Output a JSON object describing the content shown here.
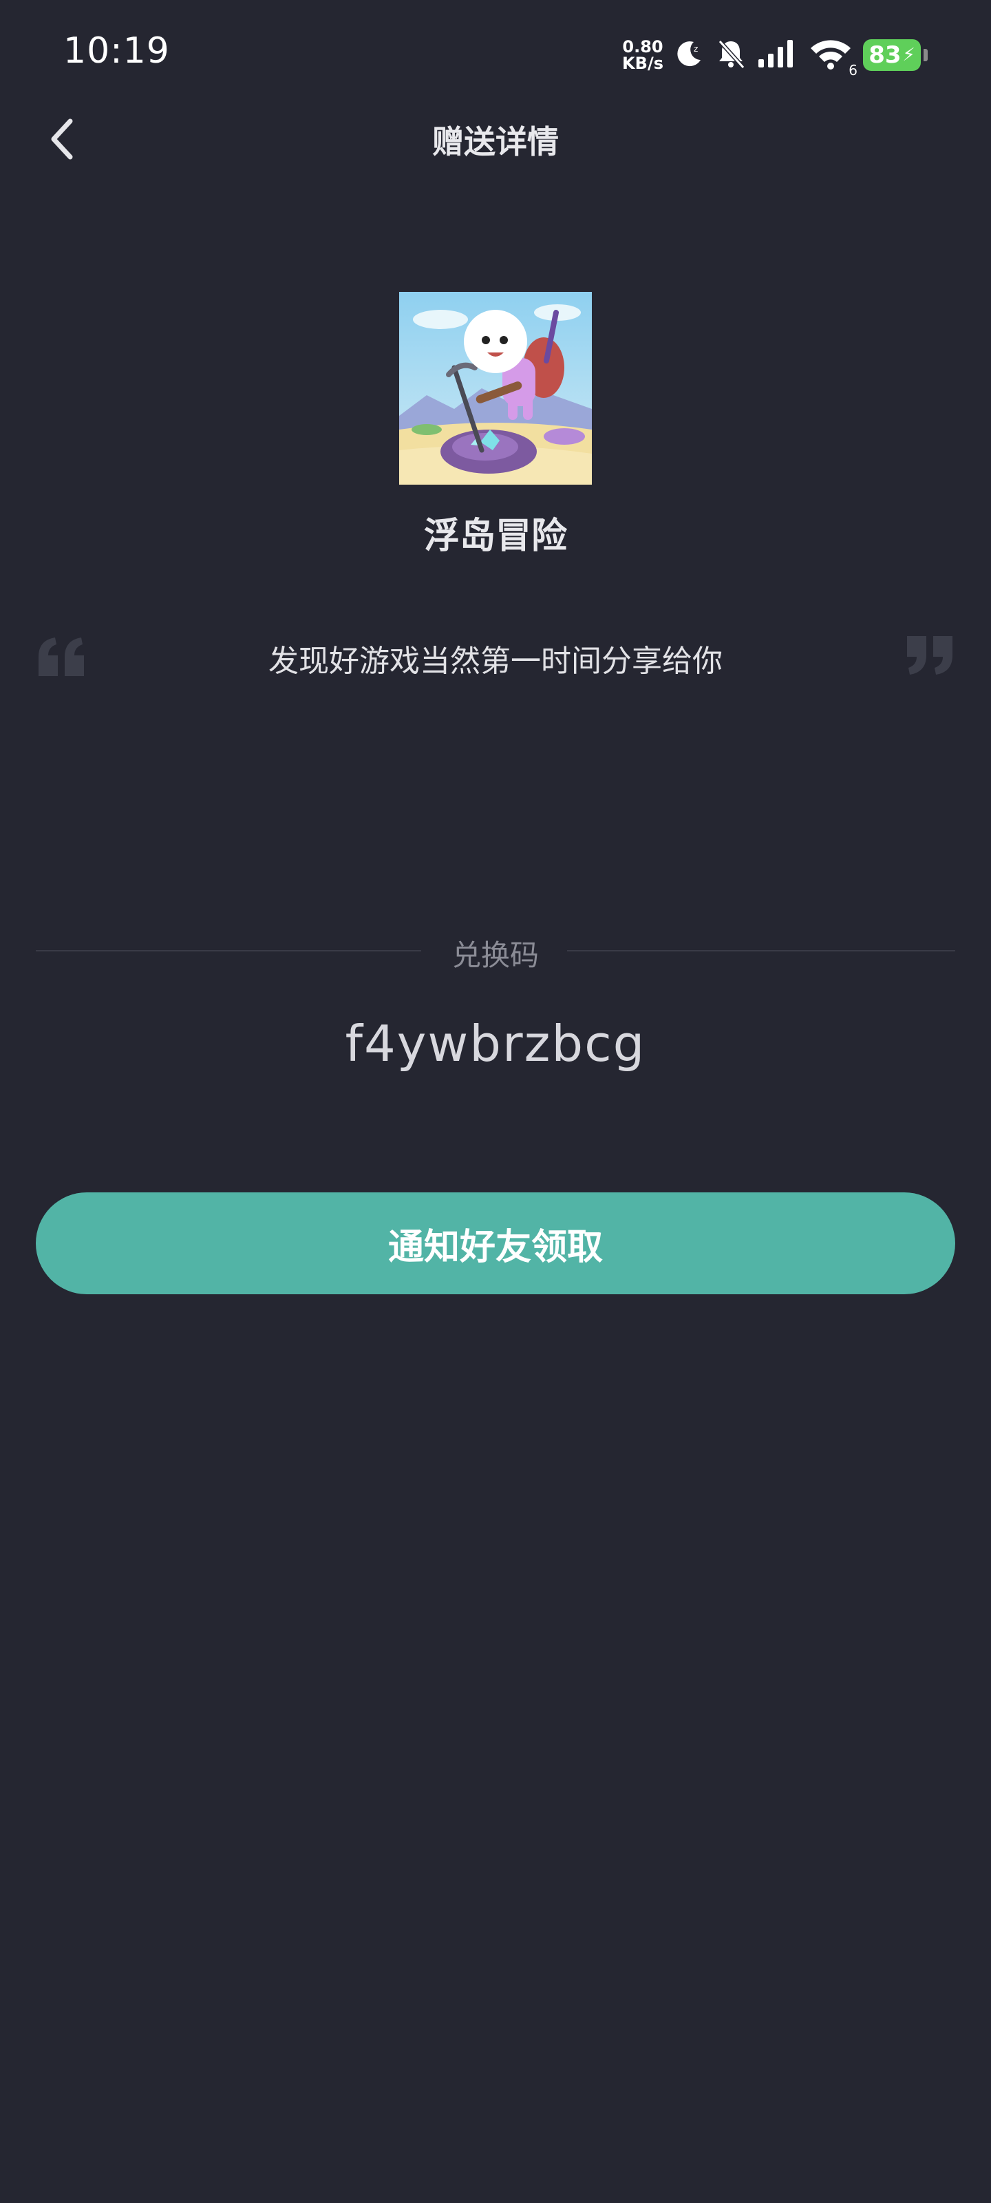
{
  "status_bar": {
    "time": "10:19",
    "net_speed_value": "0.80",
    "net_speed_unit": "KB/s",
    "wifi_badge": "6",
    "battery": "83"
  },
  "header": {
    "title": "赠送详情",
    "back_icon": "chevron-left-icon"
  },
  "game": {
    "name": "浮岛冒险"
  },
  "message": "发现好游戏当然第一时间分享给你",
  "redeem": {
    "label": "兑换码",
    "code": "f4ywbrzbcg"
  },
  "actions": {
    "notify_label": "通知好友领取"
  },
  "colors": {
    "background": "#252631",
    "accent": "#52b4a6",
    "battery": "#5fcf5a"
  }
}
